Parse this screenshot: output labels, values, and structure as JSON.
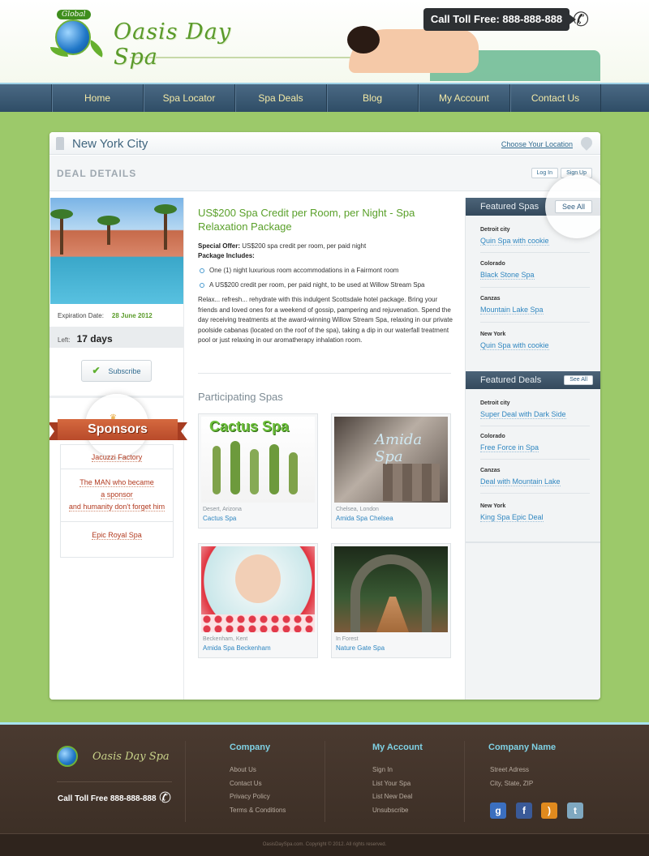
{
  "header": {
    "global_tag": "Global",
    "brand": "Oasis Day Spa",
    "phone_label": "Call Toll Free: 888-888-888"
  },
  "nav": [
    "Home",
    "Spa Locator",
    "Spa Deals",
    "Blog",
    "My Account",
    "Contact Us"
  ],
  "location": {
    "city": "New York City",
    "choose_label": "Choose Your Location"
  },
  "deal_bar": {
    "title": "DEAL DETAILS",
    "login": "Log In",
    "signup": "Sign Up"
  },
  "deal_info": {
    "expiration_label": "Expiration Date:",
    "expiration_date": "28 June 2012",
    "left_label": "Left:",
    "left_value": "17 days",
    "subscribe": "Subscribe"
  },
  "sponsors": {
    "title": "Sponsors",
    "items": [
      "Jacuzzi Factory",
      "The MAN who became",
      "a sponsor",
      "and humanity don't forget him",
      "Epic Royal Spa"
    ]
  },
  "deal": {
    "title": "US$200 Spa Credit per Room, per Night - Spa Relaxation Package",
    "special_offer_label": "Special Offer:",
    "special_offer": " US$200 spa credit per room, per paid night",
    "package_label": "Package Includes:",
    "bullets": [
      "One (1) night luxurious room accommodations in a Fairmont room",
      "A US$200 credit per room, per paid night, to be used at Willow Stream Spa"
    ],
    "description": "Relax... refresh... rehydrate with this indulgent Scottsdale hotel package. Bring your friends and loved ones for a weekend of gossip, pampering and rejuvenation. Spend the day receiving treatments at the award-winning Willow Stream Spa, relaxing in our private poolside cabanas (located on the roof of the spa), taking a dip in our waterfall treatment pool or just relaxing in our aromatherapy inhalation room."
  },
  "participating": {
    "title": "Participating Spas",
    "cards": [
      {
        "location": "Desert, Arizona",
        "name": "Cactus Spa",
        "overlay": "Cactus Spa"
      },
      {
        "location": "Chelsea, London",
        "name": "Amida Spa Chelsea",
        "overlay": "Amida Spa"
      },
      {
        "location": "Beckenham, Kent",
        "name": "Amida Spa Beckenham",
        "overlay": ""
      },
      {
        "location": "In Forest",
        "name": "Nature Gate Spa",
        "overlay": ""
      }
    ]
  },
  "featured_spas": {
    "title": "Featured Spas",
    "see_all": "See All",
    "items": [
      {
        "region": "Detroit city",
        "name": "Quin Spa with cookie"
      },
      {
        "region": "Colorado",
        "name": "Black Stone Spa"
      },
      {
        "region": "Canzas",
        "name": "Mountain Lake Spa"
      },
      {
        "region": "New York",
        "name": "Quin Spa with cookie"
      }
    ]
  },
  "featured_deals": {
    "title": "Featured Deals",
    "see_all": "See All",
    "items": [
      {
        "region": "Detroit city",
        "name": "Super Deal with Dark Side"
      },
      {
        "region": "Colorado",
        "name": "Free Force in Spa"
      },
      {
        "region": "Canzas",
        "name": "Deal with Mountain Lake"
      },
      {
        "region": "New York",
        "name": "King Spa Epic Deal"
      }
    ]
  },
  "footer": {
    "brand": "Oasis Day Spa",
    "call": "Call Toll Free 888-888-888",
    "company": {
      "title": "Company",
      "links": [
        "About Us",
        "Contact Us",
        "Privacy Policy",
        "Terms & Conditions"
      ]
    },
    "account": {
      "title": "My Account",
      "links": [
        "Sign In",
        "List Your Spa",
        "List New Deal",
        "Unsubscribe"
      ]
    },
    "company_name": {
      "title": "Company Name",
      "lines": [
        "Street Adress",
        "City, State, ZIP"
      ]
    },
    "social": [
      "g",
      "f",
      "rss",
      "t"
    ],
    "copyright": "OasisDaySpa.com. Copyright © 2012. All rights reserved."
  }
}
